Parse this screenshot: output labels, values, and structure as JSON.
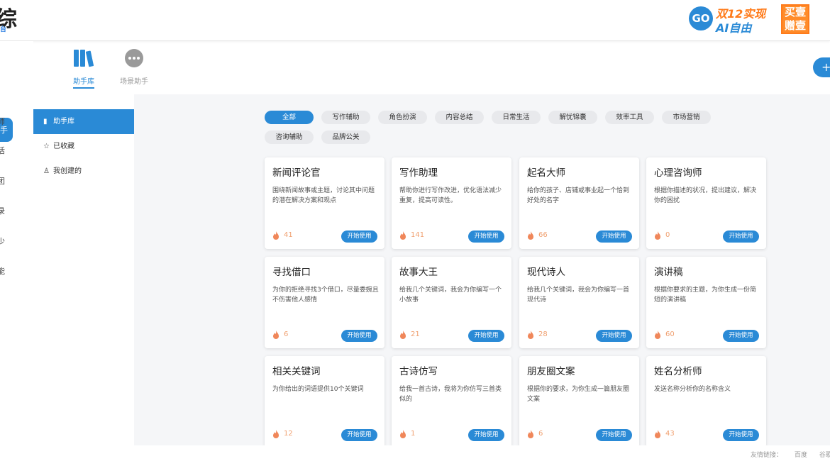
{
  "header": {
    "logo_char": "综",
    "logo_sub": "台",
    "promo": {
      "go": "GO",
      "line1": "双12实现",
      "line2": "AI自由",
      "box": "买壹赠壹"
    }
  },
  "left_rail": {
    "active_label": "手",
    "items": [
      "师",
      "活",
      "团",
      "录",
      "少",
      "能"
    ]
  },
  "tabs": [
    {
      "label": "助手库",
      "icon": "books-icon"
    },
    {
      "label": "场景助手",
      "icon": "chat-bubble-icon"
    }
  ],
  "plus_button": "+",
  "side_nav": [
    {
      "label": "助手库",
      "icon": "library-icon"
    },
    {
      "label": "已收藏",
      "icon": "star-icon"
    },
    {
      "label": "我创建的",
      "icon": "user-icon"
    }
  ],
  "chips": [
    "全部",
    "写作辅助",
    "角色扮演",
    "内容总结",
    "日常生活",
    "解忧锦囊",
    "效率工具",
    "市场营销",
    "咨询辅助",
    "品牌公关"
  ],
  "cards": [
    {
      "title": "新闻评论官",
      "desc": "围绕新闻故事或主题，讨论其中问题的潜在解决方案和观点",
      "count": "41",
      "button": "开始使用"
    },
    {
      "title": "写作助理",
      "desc": "帮助你进行写作改进，优化语法减少重复，提高可读性。",
      "count": "141",
      "button": "开始使用"
    },
    {
      "title": "起名大师",
      "desc": "给你的孩子、店铺或事业起一个恰到好处的名字",
      "count": "66",
      "button": "开始使用"
    },
    {
      "title": "心理咨询师",
      "desc": "根据你描述的状况，提出建议，解决你的困扰",
      "count": "0",
      "button": "开始使用"
    },
    {
      "title": "寻找借口",
      "desc": "为你的拒绝寻找3个借口，尽量委婉且不伤害他人感情",
      "count": "6",
      "button": "开始使用"
    },
    {
      "title": "故事大王",
      "desc": "给我几个关键词，我会为你编写一个小故事",
      "count": "21",
      "button": "开始使用"
    },
    {
      "title": "现代诗人",
      "desc": "给我几个关键词，我会为你编写一首现代诗",
      "count": "28",
      "button": "开始使用"
    },
    {
      "title": "演讲稿",
      "desc": "根据你要求的主题，为你生成一份简短的演讲稿",
      "count": "60",
      "button": "开始使用"
    },
    {
      "title": "相关关键词",
      "desc": "为你给出的词语提供10个关键词",
      "count": "12",
      "button": "开始使用"
    },
    {
      "title": "古诗仿写",
      "desc": "给我一首古诗，我将为你仿写三首类似的",
      "count": "1",
      "button": "开始使用"
    },
    {
      "title": "朋友圈文案",
      "desc": "根据你的要求，为你生成一篇朋友圈文案",
      "count": "6",
      "button": "开始使用"
    },
    {
      "title": "姓名分析师",
      "desc": "发送名称分析你的名称含义",
      "count": "43",
      "button": "开始使用"
    }
  ],
  "footer": {
    "label": "友情链接：",
    "links": [
      "百度",
      "谷歌"
    ]
  },
  "colors": {
    "accent": "#2a8ad6",
    "fire": "#f0875a"
  }
}
